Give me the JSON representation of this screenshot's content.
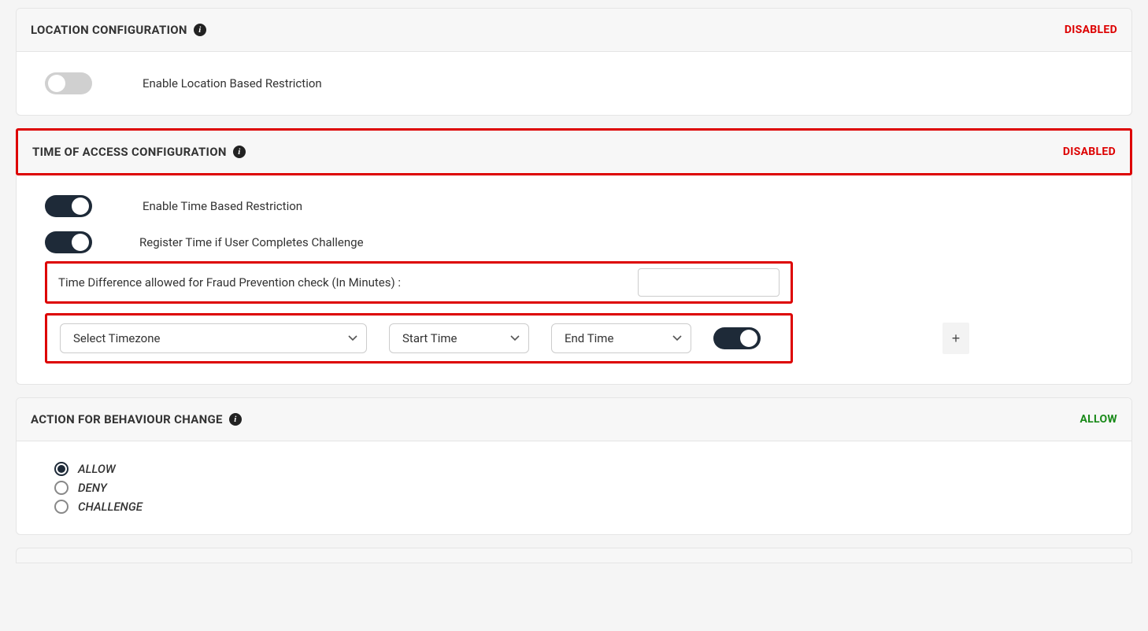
{
  "location": {
    "title": "LOCATION CONFIGURATION",
    "status": "DISABLED",
    "enable_label": "Enable Location Based Restriction",
    "enabled": false
  },
  "time": {
    "title": "TIME OF ACCESS CONFIGURATION",
    "status": "DISABLED",
    "enable_label": "Enable Time Based Restriction",
    "enabled": true,
    "register_label": "Register Time if User Completes Challenge",
    "register_enabled": true,
    "diff_label": "Time Difference allowed for Fraud Prevention check (In Minutes) :",
    "diff_value": "",
    "timezone_placeholder": "Select Timezone",
    "start_placeholder": "Start Time",
    "end_placeholder": "End Time",
    "row_toggle_enabled": true,
    "add_label": "+"
  },
  "action": {
    "title": "ACTION FOR BEHAVIOUR CHANGE",
    "status": "ALLOW",
    "options": {
      "allow": "ALLOW",
      "deny": "DENY",
      "challenge": "CHALLENGE"
    },
    "selected": "allow"
  },
  "icons": {
    "info": "i"
  }
}
